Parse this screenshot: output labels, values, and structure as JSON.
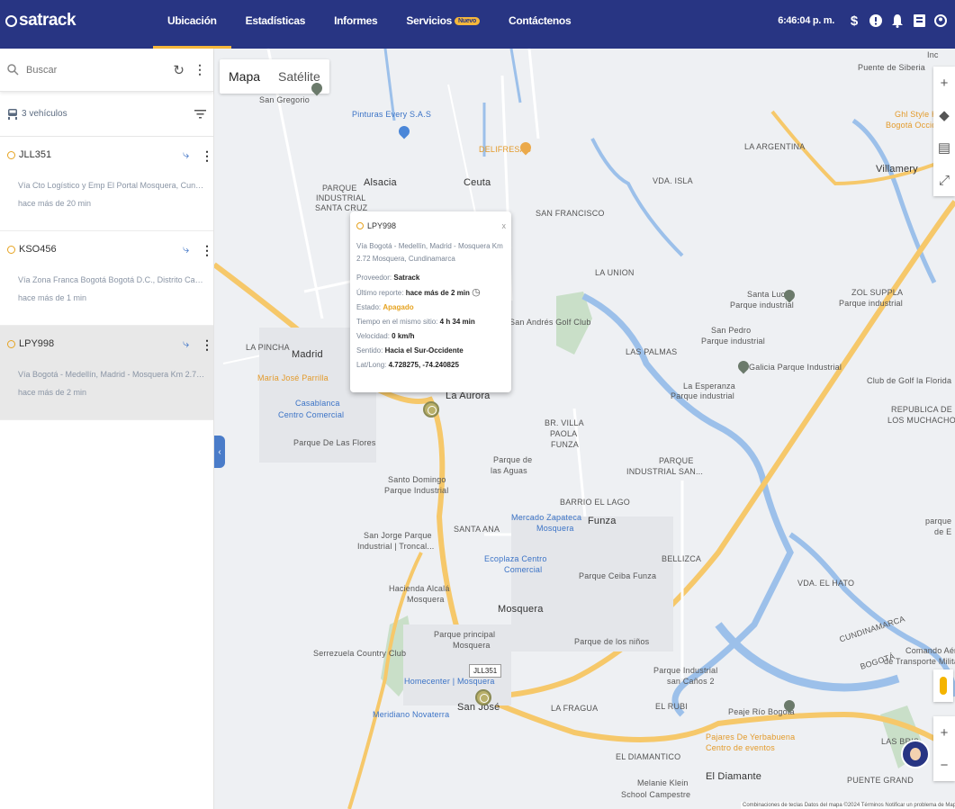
{
  "app": {
    "logo_text": "satrack",
    "time": "6:46:04 p. m."
  },
  "nav": {
    "items": [
      {
        "label": "Ubicación",
        "active": true
      },
      {
        "label": "Estadísticas",
        "active": false
      },
      {
        "label": "Informes",
        "active": false
      },
      {
        "label": "Servicios",
        "active": false,
        "badge": "Nuevo"
      },
      {
        "label": "Contáctenos",
        "active": false
      }
    ]
  },
  "top_icons": [
    "dollar-icon",
    "alert-icon",
    "bell-icon",
    "book-icon",
    "user-icon"
  ],
  "sidebar": {
    "search_placeholder": "Buscar",
    "vehicle_count": "3 vehículos",
    "vehicles": [
      {
        "plate": "JLL351",
        "address": "Vía Cto Logístico y Emp El Portal Mosquera, Cundinamarca",
        "time": "hace más de 20 min",
        "selected": false
      },
      {
        "plate": "KSO456",
        "address": "Vía Zona Franca Bogotá Bogotá D.C., Distrito Capital",
        "time": "hace más de 1 min",
        "selected": false
      },
      {
        "plate": "LPY998",
        "address": "Vía Bogotá - Medellín, Madrid - Mosquera Km 2.72 Mosquera, Cu...",
        "time": "hace más de 2 min",
        "selected": true
      }
    ]
  },
  "map": {
    "type_options": {
      "map": "Mapa",
      "satellite": "Satélite"
    },
    "popup": {
      "plate": "LPY998",
      "close": "x",
      "address": "Vía Bogotá - Medellín, Madrid - Mosquera Km 2.72 Mosquera, Cundinamarca",
      "provider_label": "Proveedor:",
      "provider": "Satrack",
      "report_label": "Último reporte:",
      "report": "hace más de 2 min",
      "state_label": "Estado:",
      "state": "Apagado",
      "time_label": "Tiempo en el mismo sitio:",
      "time": "4 h 34 min",
      "speed_label": "Velocidad:",
      "speed": "0 km/h",
      "direction_label": "Sentido:",
      "direction": "Hacia el Sur-Occidente",
      "coords_label": "Lat/Long:",
      "coords": "4.728275, -74.240825"
    },
    "vehicle_tag": "JLL351",
    "labels": {
      "san_gregorio": "San Gregorio",
      "pinturas": "Pinturas Every S.A.S",
      "delifresas": "DELIFRESAS",
      "parque_ind1": "PARQUE",
      "parque_ind2": "INDUSTRIAL",
      "parque_ind3": "SANTA CRUZ",
      "alsacia": "Alsacia",
      "ceuta": "Ceuta",
      "vda_isla": "VDA. ISLA",
      "la_argentina": "LA ARGENTINA",
      "villamery": "Villamery",
      "puente_siberia": "Puente de Siberia",
      "ghl": "Ghl Style Hot",
      "bogota_occ": "Bogotá Occiden",
      "san_francisco": "SAN FRANCISCO",
      "la_union": "LA UNION",
      "zol1": "ZOL SUPPLA",
      "zol2": "Parque industrial",
      "santa_lucia1": "Santa Lucía",
      "santa_lucia2": "Parque industrial",
      "san_andres": "San Andrés Golf Club",
      "san_pedro1": "San Pedro",
      "san_pedro2": "Parque industrial",
      "la_pincha": "LA PINCHA",
      "madrid": "Madrid",
      "maria_jose": "María José Parrilla",
      "las_palmas": "LAS PALMAS",
      "galicia": "Galicia Parque Industrial",
      "la_esperanza1": "La Esperanza",
      "la_esperanza2": "Parque industrial",
      "golf_florida": "Club de Golf la Florida",
      "casablanca1": "Casablanca",
      "casablanca2": "Centro Comercial",
      "la_aurora": "La Aurora",
      "republica1": "REPUBLICA DE",
      "republica2": "LOS MUCHACHOS",
      "parque_flores": "Parque De Las Flores",
      "villa1": "BR. VILLA",
      "villa2": "PAOLA",
      "villa3": "FUNZA",
      "parque_ind_san1": "PARQUE",
      "parque_ind_san2": "INDUSTRIAL SAN...",
      "parque_aguas1": "Parque de",
      "parque_aguas2": "las Aguas",
      "santo_domingo1": "Santo Domingo",
      "santo_domingo2": "Parque Industrial",
      "barrio_lago": "BARRIO EL LAGO",
      "santa_ana": "SANTA ANA",
      "funza": "Funza",
      "mercado1": "Mercado Zapateca",
      "mercado2": "Mosquera",
      "san_jorge1": "San Jorge Parque",
      "san_jorge2": "Industrial | Troncal...",
      "bellizca": "BELLIZCA",
      "ecoplaza1": "Ecoplaza Centro",
      "ecoplaza2": "Comercial",
      "parque_ceiba": "Parque Ceiba Funza",
      "hacienda1": "Hacienda Alcalá",
      "hacienda2": "Mosquera",
      "vda_hato": "VDA. EL HATO",
      "mosquera": "Mosquera",
      "parque_principal1": "Parque principal",
      "parque_principal2": "Mosquera",
      "parque_ninos": "Parque de los niños",
      "serrezuela": "Serrezuela Country Club",
      "comando1": "Comando Aére",
      "comando2": "de Transporte Militar",
      "homecenter": "Homecenter | Mosquera",
      "parque_ind_canos1": "Parque Industrial",
      "parque_ind_canos2": "san Caños 2",
      "san_jose": "San José",
      "meridiano": "Meridiano Novaterra",
      "la_fragua": "LA FRAGUA",
      "el_rubi": "EL RUBI",
      "peaje": "Peaje Río Bogotá",
      "pajares1": "Pajares De Yerbabuena",
      "pajares2": "Centro de eventos",
      "la_brisas": "LAS BRIS",
      "el_diamantico": "EL DIAMANTICO",
      "el_diamante": "El Diamante",
      "melanie1": "Melanie Klein",
      "melanie2": "School Campestre",
      "puente_grande": "PUENTE GRAND",
      "cundinamarca": "CUNDINAMARCA",
      "bogota_river": "BOGOTÁ",
      "inc": "Inc",
      "parque_e": "parque",
      "parque_e2": "de E"
    },
    "footer": "Combinaciones de teclas   Datos del mapa ©2024   Términos   Notificar un problema de Map"
  },
  "colors": {
    "topbar": "#283583",
    "accent": "#f5b73b",
    "road": "#f6c86a",
    "water": "#9cc0ea",
    "park": "#c9dfc8"
  }
}
